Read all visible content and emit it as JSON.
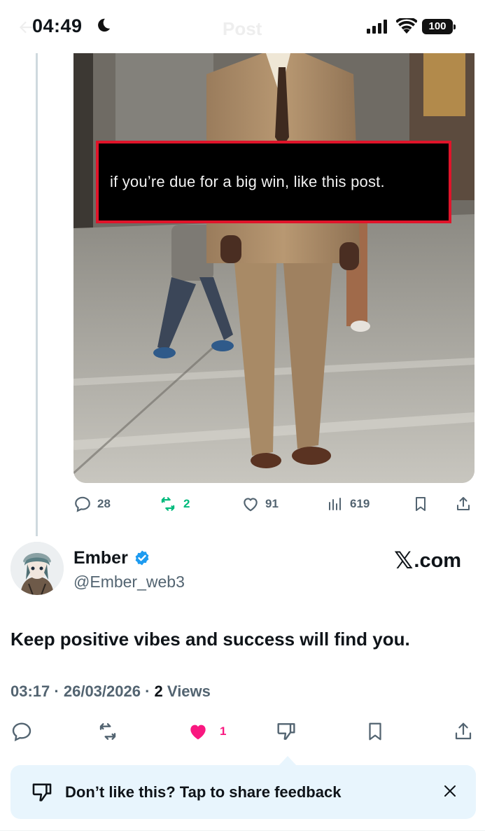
{
  "status_bar": {
    "time": "04:49",
    "battery": "100"
  },
  "header": {
    "title": "Post"
  },
  "quoted_post": {
    "caption": "if you’re due for a big win, like this post.",
    "actions": {
      "replies": "28",
      "reposts": "2",
      "likes": "91",
      "views": "619"
    }
  },
  "reply": {
    "author_name": "Ember",
    "author_handle": "@Ember_web3",
    "source_logo_suffix": ".com",
    "text": "Keep positive vibes and success will find you.",
    "time": "03:17",
    "date": "26/03/2026",
    "views_count": "2",
    "views_label": "Views",
    "actions": {
      "likes": "1"
    }
  },
  "feedback_banner": {
    "text": "Don’t like this? Tap to share feedback"
  },
  "colors": {
    "accent_blue": "#1d9bf0",
    "repost_green": "#00ba7c",
    "like_pink": "#f91880",
    "muted": "#536471",
    "caption_border": "#e0142a"
  },
  "icons": [
    "back-arrow-icon",
    "moon-icon",
    "signal-icon",
    "wifi-icon",
    "reply-icon",
    "repost-icon",
    "heart-icon",
    "views-icon",
    "bookmark-icon",
    "share-icon",
    "verified-icon",
    "dislike-icon",
    "close-icon"
  ]
}
